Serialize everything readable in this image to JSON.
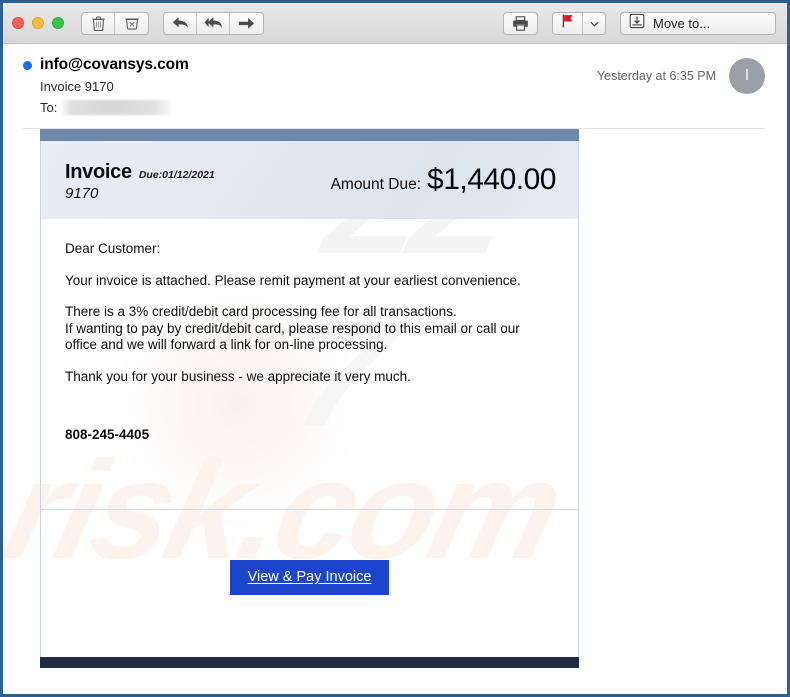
{
  "window": {
    "traffic_lights": [
      "close",
      "minimize",
      "zoom"
    ]
  },
  "toolbar": {
    "delete_label": "Delete",
    "junk_label": "Junk",
    "reply_label": "Reply",
    "reply_all_label": "Reply All",
    "forward_label": "Forward",
    "print_label": "Print",
    "flag_label": "Flag",
    "flag_menu_label": "Flag options",
    "move_to_label": "Move to...",
    "flag_color": "#e8162a"
  },
  "message": {
    "sender": "info@covansys.com",
    "subject": "Invoice 9170",
    "to_label": "To:",
    "to_value": "",
    "timestamp": "Yesterday at 6:35 PM",
    "avatar_initial": "I",
    "unread_color": "#1473e6"
  },
  "invoice": {
    "title": "Invoice",
    "due_label": "Due:01/12/2021",
    "number": "9170",
    "amount_label": "Amount Due:",
    "amount_value": "$1,440.00",
    "greeting": "Dear Customer:",
    "paragraph_1": "Your invoice is attached. Please remit payment at your earliest convenience.",
    "paragraph_2_line_1": "There is a 3% credit/debit card processing fee for all transactions.",
    "paragraph_2_line_2": "If wanting to pay by credit/debit card, please respond to this email or call our",
    "paragraph_2_line_3": "office and we will forward a link for on-line processing.",
    "paragraph_3": "Thank you for your business - we appreciate it very much.",
    "phone": "808-245-4405",
    "cta_label": "View & Pay Invoice",
    "cta_color": "#1b46cc",
    "header_bar_color": "#6c89ab",
    "footer_bar_color": "#1e2c44"
  },
  "watermark": {
    "text_1": "ZZ",
    "text_2": "7",
    "text_3": "risk.com"
  }
}
